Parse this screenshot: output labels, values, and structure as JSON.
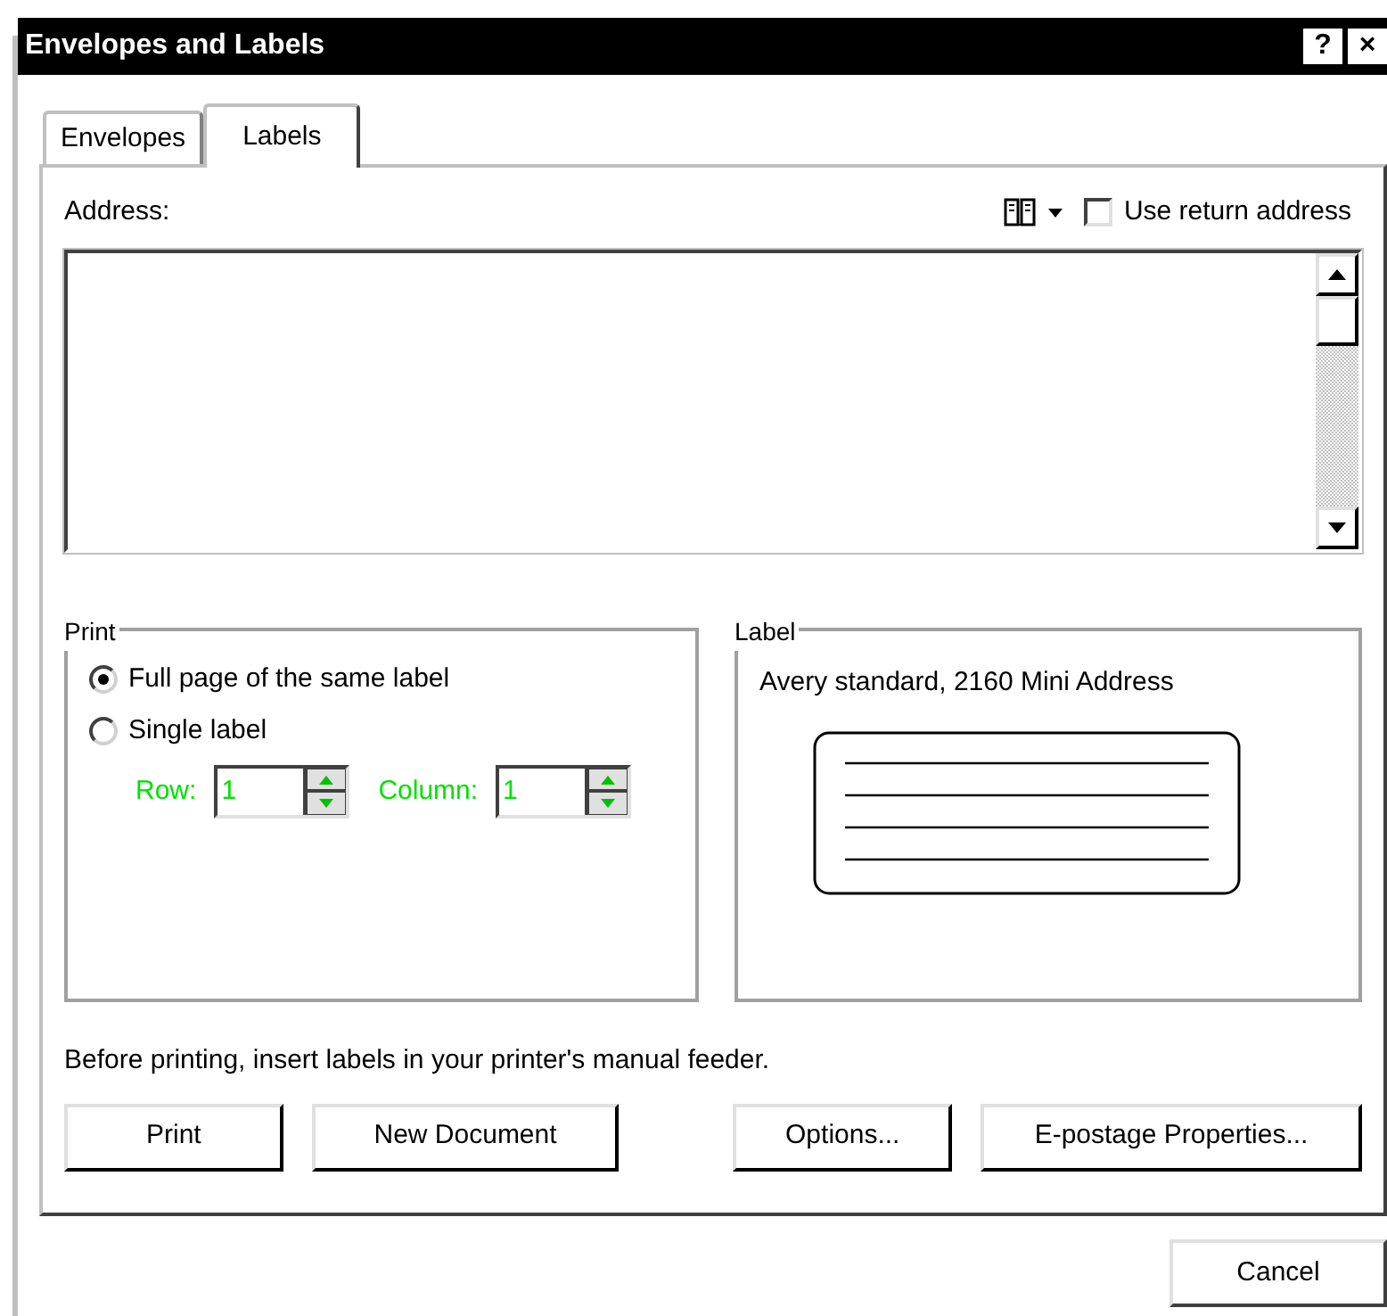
{
  "window": {
    "title": "Envelopes and Labels",
    "controls": [
      "?",
      "×"
    ]
  },
  "tabs": [
    {
      "label": "Envelopes",
      "selected": false
    },
    {
      "label": "Labels",
      "selected": true
    }
  ],
  "address": {
    "label": "Address:",
    "use_return_address": {
      "label": "Use return address",
      "checked": false
    }
  },
  "print_group": {
    "title": "Print",
    "options": [
      {
        "label": "Full page of the same label",
        "selected": true
      },
      {
        "label": "Single label",
        "selected": false
      }
    ],
    "row": {
      "label": "Row:",
      "value": "1"
    },
    "column": {
      "label": "Column:",
      "value": "1"
    }
  },
  "label_group": {
    "title": "Label",
    "description": "Avery standard, 2160 Mini Address"
  },
  "note": "Before printing, insert labels in your printer's manual feeder.",
  "buttons": [
    "Print",
    "New Document",
    "Options...",
    "E-postage Properties..."
  ],
  "footer_buttons": [
    "Cancel"
  ]
}
